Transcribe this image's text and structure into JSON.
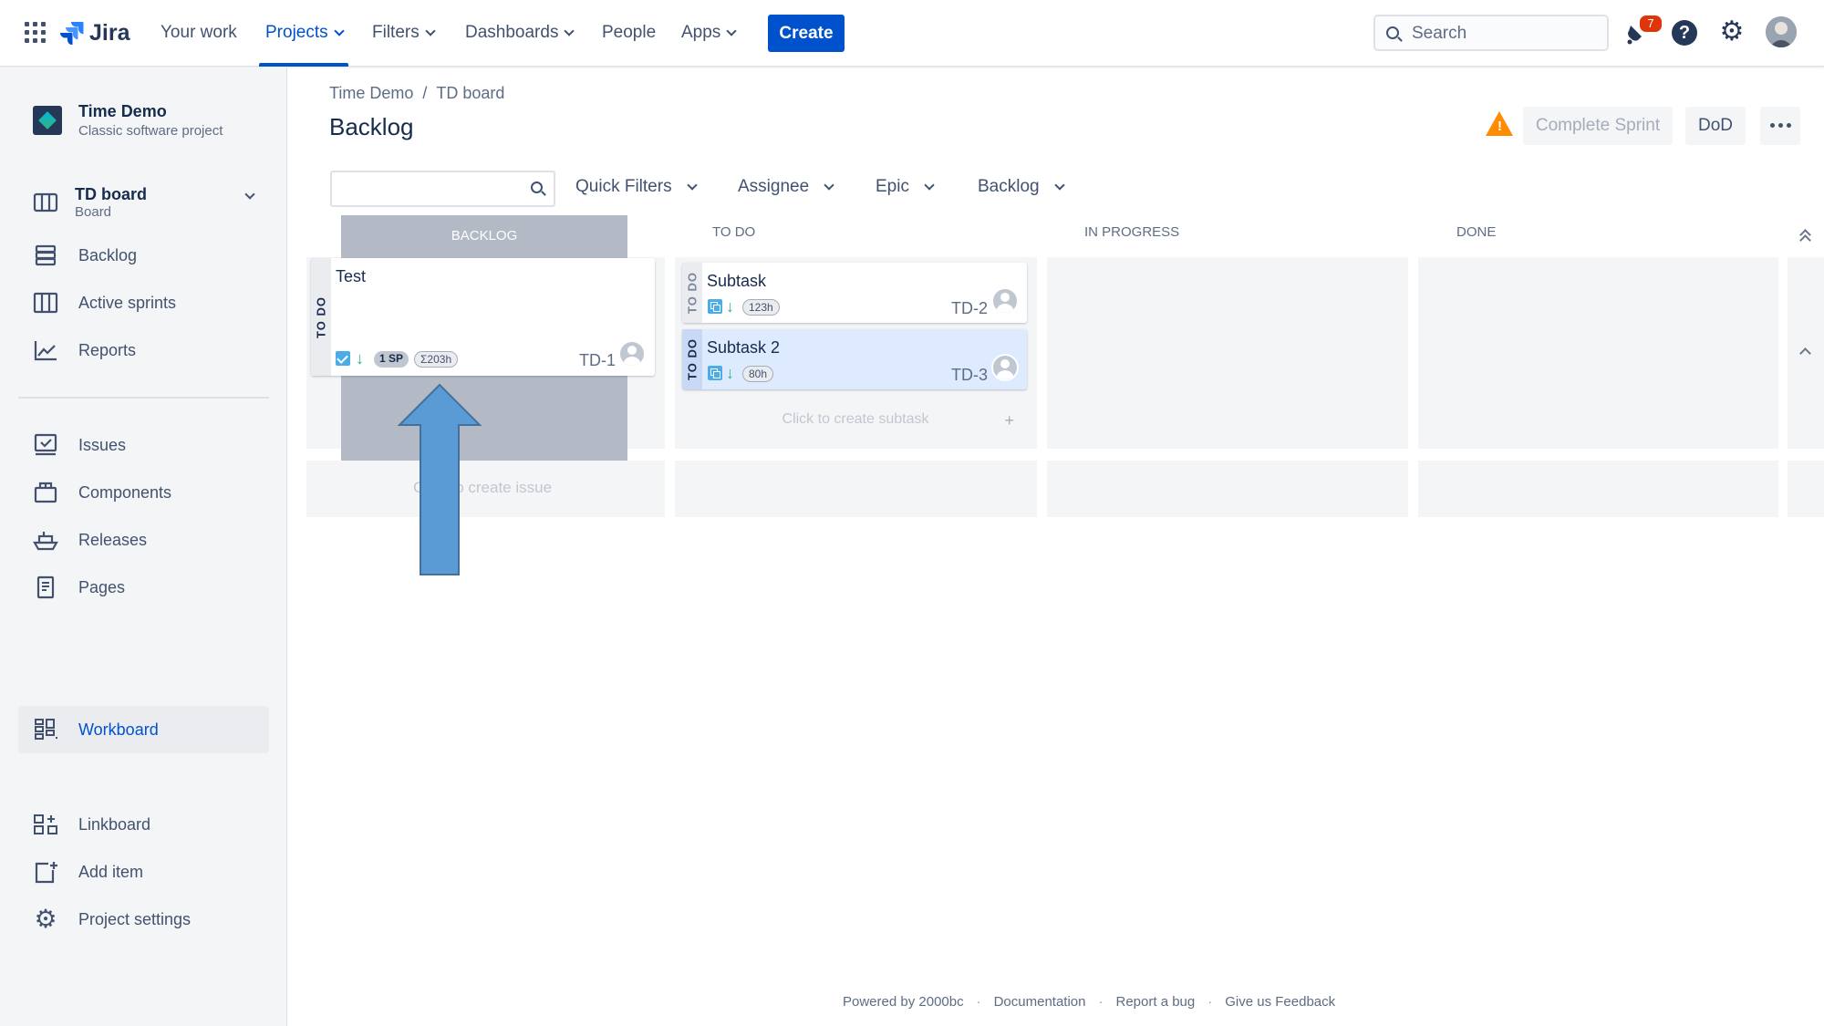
{
  "topnav": {
    "logo": "Jira",
    "items": [
      {
        "label": "Your work"
      },
      {
        "label": "Projects"
      },
      {
        "label": "Filters"
      },
      {
        "label": "Dashboards"
      },
      {
        "label": "People"
      },
      {
        "label": "Apps"
      }
    ],
    "create_label": "Create",
    "search_placeholder": "Search",
    "notifications_count": "7",
    "help_glyph": "?",
    "icons": [
      "app-switcher-icon",
      "notifications-icon",
      "help-icon",
      "settings-icon",
      "user-avatar"
    ]
  },
  "sidebar": {
    "project_name": "Time Demo",
    "project_type": "Classic software project",
    "board_name": "TD board",
    "board_type": "Board",
    "items": [
      {
        "label": "Backlog",
        "icon": "backlog-icon"
      },
      {
        "label": "Active sprints",
        "icon": "board-icon"
      },
      {
        "label": "Reports",
        "icon": "reports-icon"
      },
      {
        "label": "Issues",
        "icon": "issues-icon"
      },
      {
        "label": "Components",
        "icon": "components-icon"
      },
      {
        "label": "Releases",
        "icon": "releases-icon"
      },
      {
        "label": "Pages",
        "icon": "pages-icon"
      },
      {
        "label": "Workboard",
        "icon": "workboard-icon",
        "selected": true
      },
      {
        "label": "Linkboard",
        "icon": "linkboard-icon"
      },
      {
        "label": "Add item",
        "icon": "add-item-icon"
      },
      {
        "label": "Project settings",
        "icon": "settings-icon"
      }
    ]
  },
  "breadcrumb": {
    "project": "Time Demo",
    "separator": "/",
    "board": "TD board"
  },
  "page_title": "Backlog",
  "actions": {
    "complete_sprint": "Complete Sprint",
    "dod": "DoD",
    "warning_glyph": "!"
  },
  "filters": {
    "search_value": "",
    "items": [
      {
        "label": "Quick Filters"
      },
      {
        "label": "Assignee"
      },
      {
        "label": "Epic"
      },
      {
        "label": "Backlog"
      }
    ]
  },
  "board": {
    "columns": [
      {
        "label": "BACKLOG"
      },
      {
        "label": "TO DO"
      },
      {
        "label": "IN PROGRESS"
      },
      {
        "label": "DONE"
      }
    ],
    "parent_card": {
      "status": "TO DO",
      "summary": "Test",
      "story_points": "1 SP",
      "estimate": "Σ203h",
      "key": "TD-1"
    },
    "subtasks": [
      {
        "status": "TO DO",
        "summary": "Subtask",
        "estimate": "123h",
        "key": "TD-2"
      },
      {
        "status": "TO DO",
        "summary": "Subtask 2",
        "estimate": "80h",
        "key": "TD-3",
        "selected": true
      }
    ],
    "create_subtask": "Click to create subtask",
    "create_subtask_plus": "+",
    "create_issue": "Click to create issue"
  },
  "footer": {
    "powered_by": "Powered by 2000bc",
    "links": [
      "Documentation",
      "Report a bug",
      "Give us Feedback"
    ],
    "dot": "·"
  },
  "colors": {
    "accent": "#0052cc",
    "warning": "#ff8b00",
    "badge": "#de350b",
    "arrow": "#5b9bd5"
  }
}
